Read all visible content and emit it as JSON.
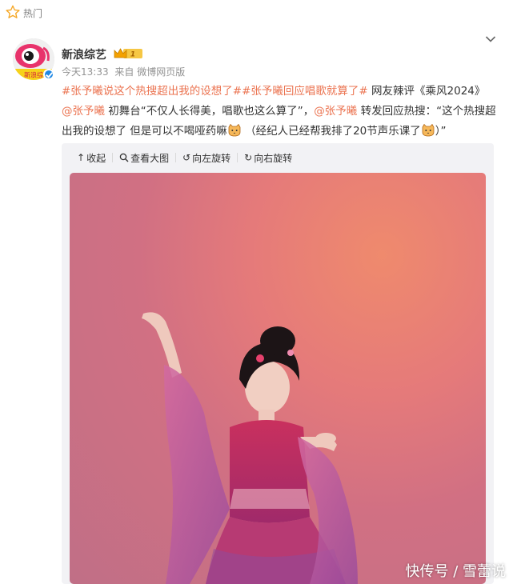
{
  "header": {
    "hot_label": "热门",
    "star_icon": "star-icon"
  },
  "post": {
    "username": "新浪综艺",
    "avatar_caption": "新浪综",
    "badge_level": "1",
    "timestamp": "今天13:33",
    "from_label": "来自",
    "source": "微博网页版",
    "body": {
      "topic1": "#张予曦说这个热搜超出我的设想了#",
      "topic2": "#张予曦回应唱歌就算了#",
      "text1": " 网友辣评《乘风2024》",
      "mention1": "@张予曦",
      "text2": " 初舞台“不仅人长得美，唱歌也这么算了”，",
      "mention2": "@张予曦",
      "text3": " 转发回应热搜：“这个热搜超出我的设想了 但是可以不喝哑药嘛",
      "text4": " （经纪人已经帮我排了20节声乐课了",
      "text5": "）”"
    }
  },
  "media_toolbar": {
    "collapse": "收起",
    "view_large": "查看大图",
    "rotate_left": "向左旋转",
    "rotate_right": "向右旋转"
  },
  "watermark": "快传号 / 雪蕾说",
  "colors": {
    "accent": "#eb7350",
    "verified": "#1e88e5"
  }
}
